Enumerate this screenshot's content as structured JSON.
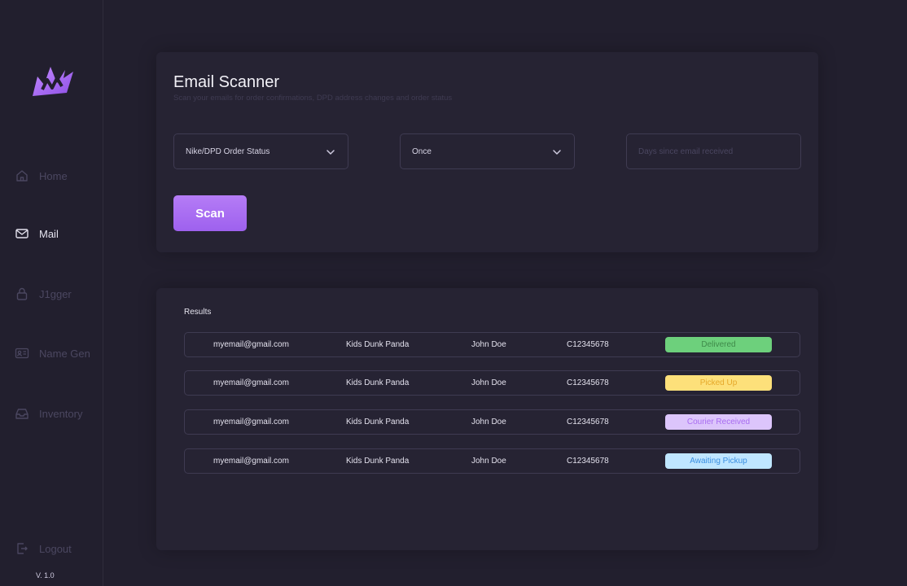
{
  "sidebar": {
    "items": [
      {
        "key": "home",
        "label": "Home",
        "icon": "home-icon",
        "active": false
      },
      {
        "key": "mail",
        "label": "Mail",
        "icon": "mail-icon",
        "active": true
      },
      {
        "key": "jigger",
        "label": "J1gger",
        "icon": "lock-icon",
        "active": false
      },
      {
        "key": "name-gen",
        "label": "Name Gen",
        "icon": "id-card-icon",
        "active": false
      },
      {
        "key": "inventory",
        "label": "Inventory",
        "icon": "inbox-icon",
        "active": false
      }
    ],
    "logout_label": "Logout",
    "version": "V. 1.0"
  },
  "scanner": {
    "title": "Email Scanner",
    "subtitle": "Scan your emails for order confirmations, DPD address changes and order status",
    "type_select": {
      "value": "Nike/DPD Order Status"
    },
    "frequency_select": {
      "value": "Once"
    },
    "days_input": {
      "placeholder": "Days since email received",
      "value": ""
    },
    "scan_label": "Scan"
  },
  "results": {
    "label": "Results",
    "rows": [
      {
        "email": "myemail@gmail.com",
        "product": "Kids Dunk Panda",
        "name": "John Doe",
        "order": "C12345678",
        "status": "Delivered"
      },
      {
        "email": "myemail@gmail.com",
        "product": "Kids Dunk Panda",
        "name": "John Doe",
        "order": "C12345678",
        "status": "Picked Up"
      },
      {
        "email": "myemail@gmail.com",
        "product": "Kids Dunk Panda",
        "name": "John Doe",
        "order": "C12345678",
        "status": "Courier Received"
      },
      {
        "email": "myemail@gmail.com",
        "product": "Kids Dunk Panda",
        "name": "John Doe",
        "order": "C12345678",
        "status": "Awaiting Pickup"
      }
    ]
  },
  "colors": {
    "accent": "#a56cf2",
    "background": "#221f2e",
    "card": "#262333",
    "status_delivered_bg": "#6dd07c",
    "status_delivered_text": "#3f8a4a",
    "status_picked_bg": "#fde07a",
    "status_picked_text": "#e6a82a",
    "status_courier_bg": "#dcc5fb",
    "status_courier_text": "#a86cf0",
    "status_awaiting_bg": "#bfe6ff",
    "status_awaiting_text": "#3a8fe0"
  }
}
